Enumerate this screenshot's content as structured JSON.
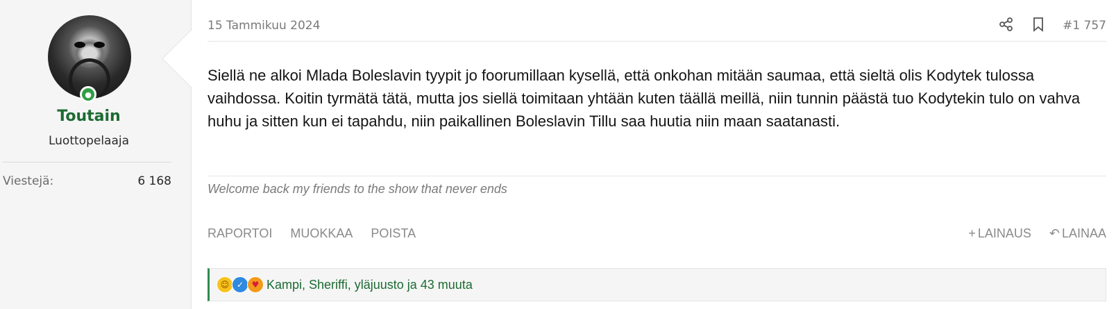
{
  "user": {
    "name": "Toutain",
    "title": "Luottopelaaja",
    "stats": [
      {
        "label": "Viestejä:",
        "value": "6 168"
      }
    ]
  },
  "post": {
    "date": "15 Tammikuu 2024",
    "number": "#1 757",
    "body": "Siellä ne alkoi Mlada Boleslavin tyypit jo foorumillaan kysellä, että onkohan mitään saumaa, että sieltä olis Kodytek tulossa vaihdossa. Koitin tyrmätä tätä, mutta jos siellä toimitaan yhtään kuten täällä meillä, niin tunnin päästä tuo Kodytekin tulo on vahva huhu ja sitten kun ei tapahdu, niin paikallinen Boleslavin Tillu saa huutia niin maan saatanasti.",
    "signature": "Welcome back my friends to the show that never ends",
    "actions_left": [
      "RAPORTOI",
      "MUOKKAA",
      "POISTA"
    ],
    "actions_right": [
      {
        "label": "LAINAUS",
        "icon": "plus"
      },
      {
        "label": "LAINAA",
        "icon": "reply"
      }
    ],
    "reactions": {
      "icons": [
        "laugh",
        "like",
        "love"
      ],
      "text": "Kampi, Sheriffi, yläjuusto ja 43 muuta"
    }
  },
  "colors": {
    "accent": "#1c6b32",
    "online": "#2f9e44"
  }
}
